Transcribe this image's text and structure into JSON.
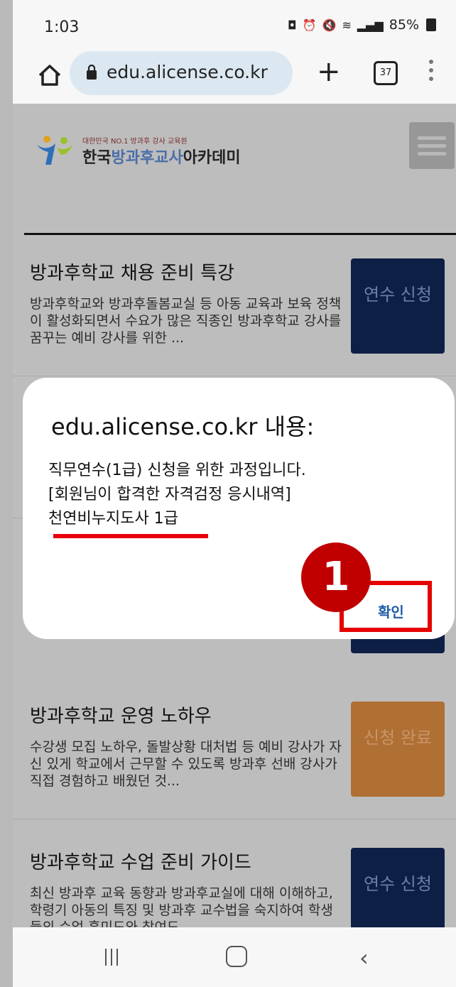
{
  "status_bar": {
    "time": "1:03",
    "battery": "85%"
  },
  "browser": {
    "url": "edu.alicense.co.kr",
    "tab_count": "37"
  },
  "site": {
    "logo_sub": "대한민국 NO.1 방과후 강사 교육원",
    "logo_name_part1": "한국",
    "logo_name_part2": "방과후교사",
    "logo_name_part3": "아카데미"
  },
  "courses": [
    {
      "title": "방과후학교 채용 준비 특강",
      "desc": "방과후학교와 방과후돌봄교실 등 아동 교육과 보육 정책이 활성화되면서 수요가 많은 직종인 방과후학교 강사를 꿈꾸는 예비 강사를 위한 ...",
      "button": "연수 신청",
      "button_color": "#0e1f45"
    },
    {
      "title": "방과후학교 운영 노하우",
      "desc": "수강생 모집 노하우, 돌발상황 대처법 등 예비 강사가 자신 있게 학교에서 근무할 수 있도록 방과후 선배 강사가 직접 경험하고 배웠던 것...",
      "button": "신청 완료",
      "button_color": "#b06f33"
    },
    {
      "title": "방과후학교 수업 준비 가이드",
      "desc": "최신 방과후 교육 동향과 방과후교실에 대해 이해하고, 학령기 아동의 특징 및 방과후 교수법을 숙지하여 학생들의 수업 흥미도와 참여도",
      "button": "연수 신청",
      "button_color": "#0e1f45"
    }
  ],
  "dialog": {
    "title": "edu.alicense.co.kr 내용:",
    "line1": "직무연수(1급) 신청을 위한 과정입니다.",
    "line2": "[회원님이 합격한 자격검정 응시내역]",
    "line3": "천연비누지도사 1급",
    "confirm": "확인"
  },
  "annotation": {
    "step_number": "1",
    "highlight_color": "#e60000"
  }
}
